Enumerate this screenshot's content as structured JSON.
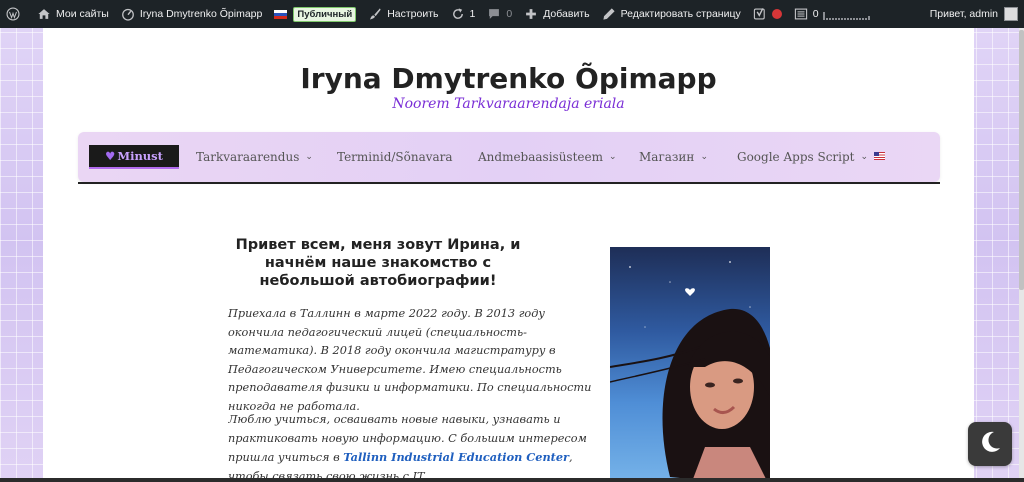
{
  "adminbar": {
    "my_sites": "Мои сайты",
    "site_name": "Iryna Dmytrenko Õpimapp",
    "public_badge": "Публичный",
    "customize": "Настроить",
    "updates_count": "1",
    "comments_count": "0",
    "add_new": "Добавить",
    "edit_page": "Редактировать страницу",
    "stats_count": "0",
    "greeting": "Привет, admin",
    "icons": {
      "wp": "wordpress-icon",
      "home": "home-icon",
      "dashboard": "dashboard-icon",
      "brush": "paintbrush-icon",
      "updates": "refresh-icon",
      "comments": "comment-icon",
      "plus": "plus-icon",
      "pencil": "pencil-icon",
      "seo": "yoast-icon",
      "stats": "stats-icon"
    }
  },
  "site": {
    "title": "Iryna Dmytrenko Õpimapp",
    "tagline": "Noorem Tarkvaraarendaja eriala"
  },
  "nav": {
    "items": [
      {
        "label": "Minust",
        "active": true
      },
      {
        "label": "Tarkvaraarendus",
        "dropdown": true
      },
      {
        "label": "Terminid/Sõnavara",
        "dropdown": false
      },
      {
        "label": "Andmebaasisüsteem",
        "dropdown": true
      },
      {
        "label": "Магазин",
        "dropdown": true
      },
      {
        "label": "Google Apps Script",
        "dropdown": true
      }
    ],
    "language_flag": "us-flag-icon"
  },
  "content": {
    "heading": "Привет всем, меня зовут Ирина, и начнём наше знакомство с небольшой автобиографии!",
    "paragraph1": "Приехала в Таллинн в марте 2022 году. В 2013 году окончила педагогический лицей (специальность- математика). В 2018 году окончила магистратуру в Педагогическом Университете. Имею специальность преподавателя физики и информатики. По специальности никогда не работала.",
    "paragraph2_before": "Люблю учиться, осваивать новые навыки, узнавать и практиковать новую информацию. С большим интересом пришла учиться в ",
    "paragraph2_link": "Tallinn Industrial Education Center",
    "paragraph2_after": ", чтобы связать свою жизнь с IT."
  },
  "colors": {
    "adminbar_bg": "#1d2327",
    "tagline": "#7a2ed6",
    "nav_active_bg": "#1a1a1a",
    "nav_active_text": "#c9a2ff",
    "link": "#1f5fbf"
  }
}
